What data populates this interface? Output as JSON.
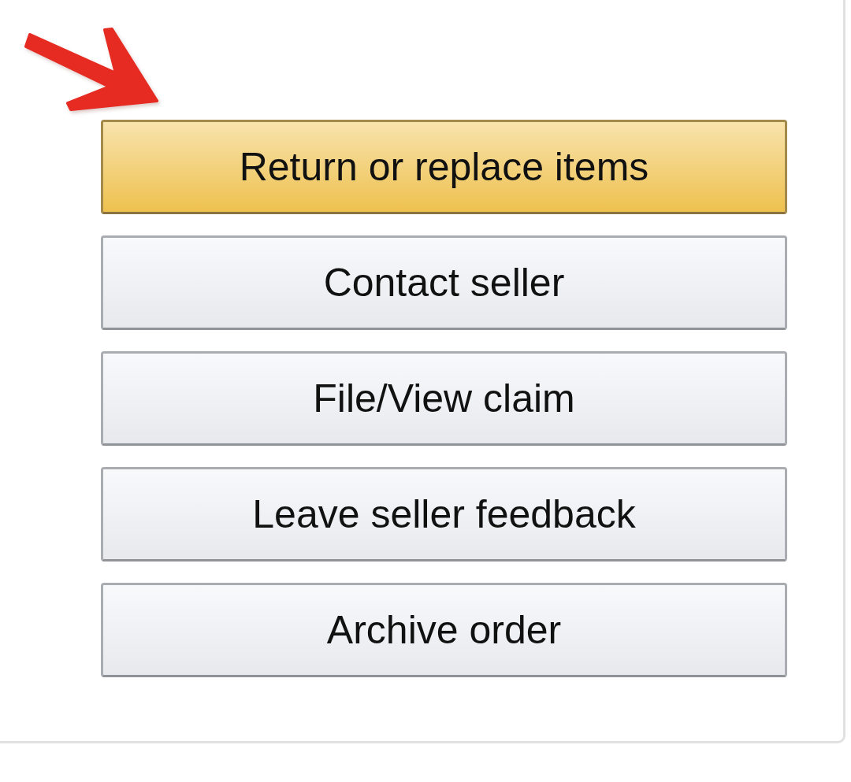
{
  "buttons": [
    {
      "label": "Return or replace items",
      "kind": "primary"
    },
    {
      "label": "Contact seller",
      "kind": "secondary"
    },
    {
      "label": "File/View claim",
      "kind": "secondary"
    },
    {
      "label": "Leave seller feedback",
      "kind": "secondary"
    },
    {
      "label": "Archive order",
      "kind": "secondary"
    }
  ]
}
